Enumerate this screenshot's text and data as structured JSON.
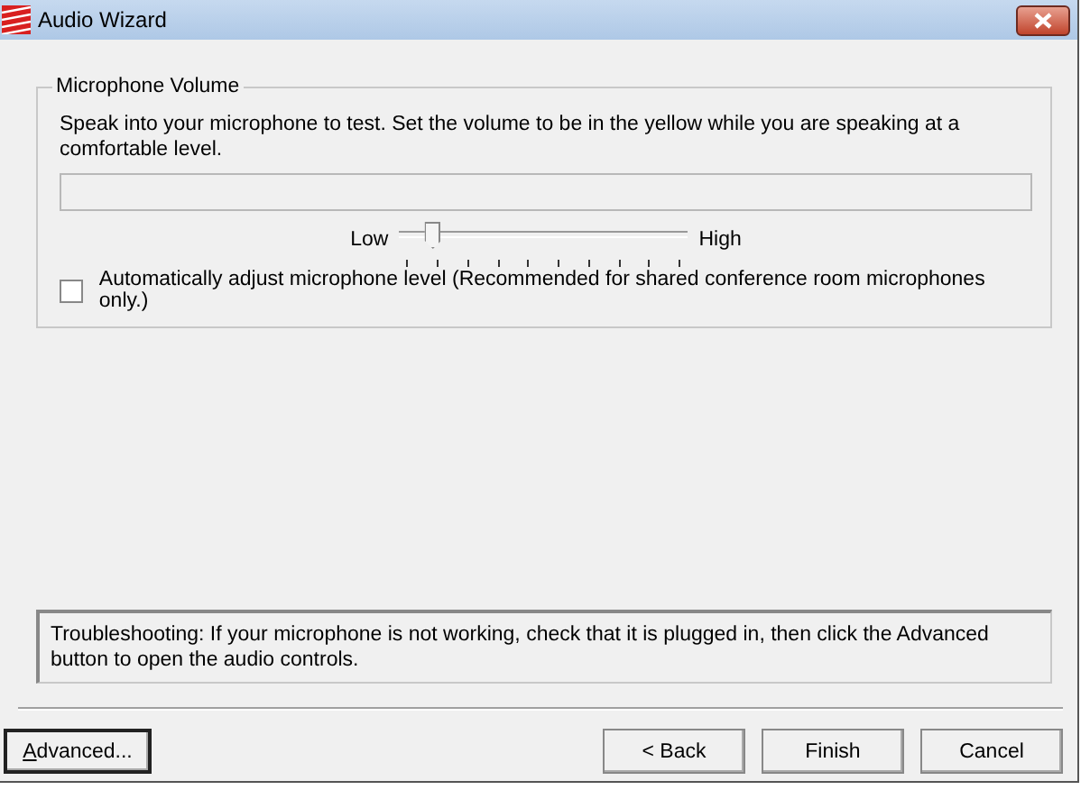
{
  "window": {
    "title": "Audio Wizard"
  },
  "microphone_volume": {
    "title": "Microphone Volume",
    "instructions": "Speak into your microphone to test. Set the volume to be in the yellow while you are speaking at a comfortable level.",
    "slider": {
      "low_label": "Low",
      "high_label": "High",
      "level": 0.12
    },
    "auto_adjust": {
      "label": "Automatically adjust microphone level (Recommended for shared conference room microphones only.)",
      "checked": false
    }
  },
  "troubleshooting": "Troubleshooting: If your microphone is not working, check that it is plugged in, then click the Advanced button to open the audio controls.",
  "buttons": [
    {
      "label": "Advanced...",
      "kind": "left"
    },
    {
      "label": "< Back",
      "kind": "right"
    },
    {
      "label": "Finish",
      "kind": "right"
    },
    {
      "label": "Cancel",
      "kind": "right"
    }
  ]
}
